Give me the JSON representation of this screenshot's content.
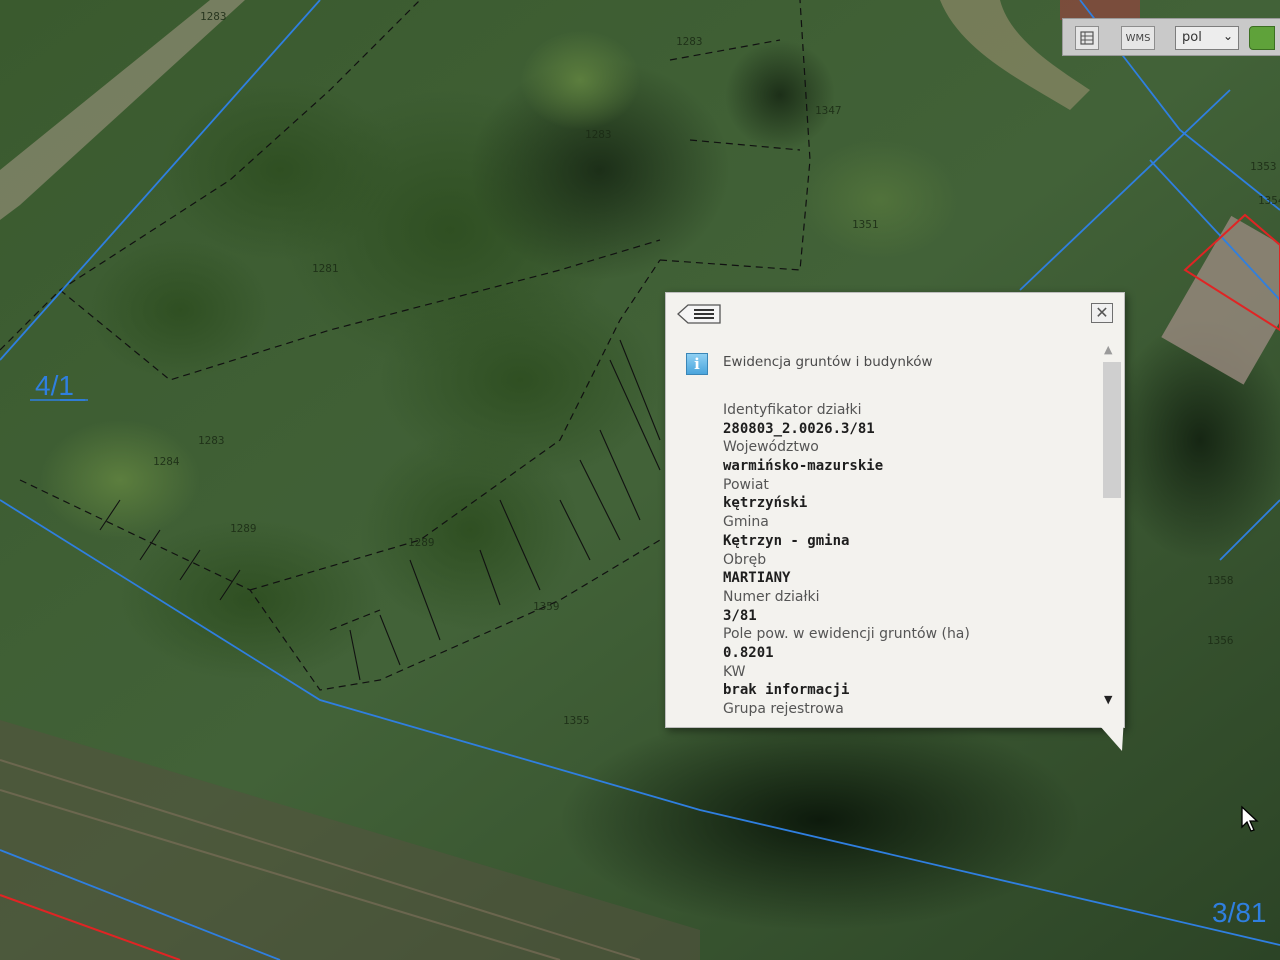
{
  "map": {
    "parcel_labels": [
      "4/1",
      "3/81"
    ],
    "small_numbers": [
      "1283",
      "1283",
      "1283",
      "1281",
      "1283",
      "1284",
      "1289",
      "1289",
      "1359",
      "1355",
      "1351",
      "1353",
      "1354",
      "1358",
      "1356",
      "1347"
    ]
  },
  "toolbar": {
    "wms_label": "WMS",
    "language": "pol",
    "language_icon": "chevron-down-icon"
  },
  "popup": {
    "title": "Ewidencja gruntów i budynków",
    "info_icon_text": "i",
    "close_icon_text": "✕",
    "fields": [
      {
        "label": "Identyfikator działki",
        "value": "280803_2.0026.3/81"
      },
      {
        "label": "Województwo",
        "value": "warmińsko-mazurskie"
      },
      {
        "label": "Powiat",
        "value": "kętrzyński"
      },
      {
        "label": "Gmina",
        "value": "Kętrzyn - gmina"
      },
      {
        "label": "Obręb",
        "value": "MARTIANY"
      },
      {
        "label": "Numer działki",
        "value": "3/81"
      },
      {
        "label": "Pole pow. w ewidencji gruntów (ha)",
        "value": "0.8201"
      },
      {
        "label": "KW",
        "value": "brak informacji"
      },
      {
        "label": "Grupa rejestrowa",
        "value": ""
      }
    ]
  },
  "colors": {
    "parcel_boundary": "#2f7fe0",
    "highlight_boundary": "#e02424",
    "popup_bg": "#f3f2ee"
  }
}
